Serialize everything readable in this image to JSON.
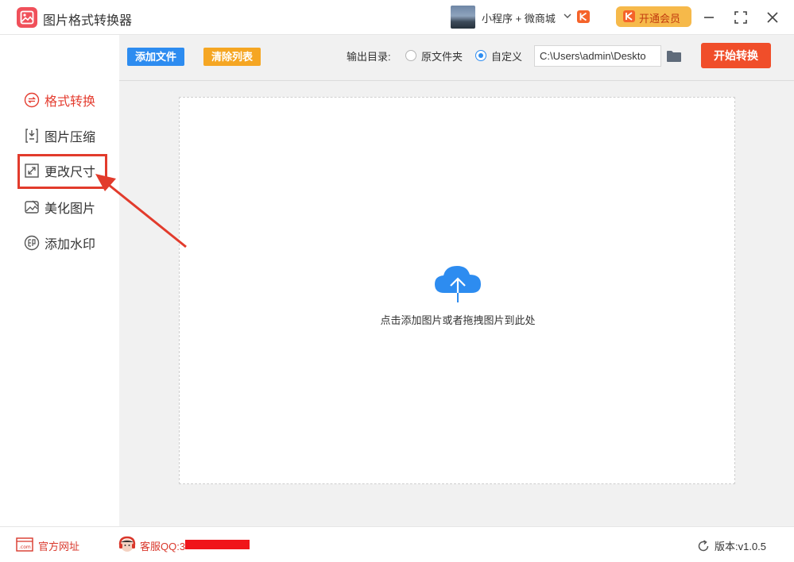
{
  "app": {
    "title": "图片格式转换器"
  },
  "header": {
    "mini_program_label": "小程序 + 微商城",
    "vip_label": "开通会员"
  },
  "sidebar": {
    "items": [
      {
        "label": "格式转换",
        "icon": "format-convert-icon",
        "active": true
      },
      {
        "label": "图片压缩",
        "icon": "compress-icon",
        "active": false
      },
      {
        "label": "更改尺寸",
        "icon": "resize-icon",
        "active": false
      },
      {
        "label": "美化图片",
        "icon": "beautify-icon",
        "active": false
      },
      {
        "label": "添加水印",
        "icon": "watermark-icon",
        "active": false
      }
    ]
  },
  "toolbar": {
    "add_file_label": "添加文件",
    "clear_list_label": "清除列表",
    "output_dir_label": "输出目录:",
    "option_original": "原文件夹",
    "option_custom": "自定义",
    "selected_option": "自定义",
    "output_path": "C:\\Users\\admin\\Deskto",
    "start_label": "开始转换"
  },
  "dropzone": {
    "hint": "点击添加图片或者拖拽图片到此处"
  },
  "footer": {
    "site_label": "官方网址",
    "service_label": "客服QQ:3",
    "version_label": "版本:v1.0.5"
  },
  "colors": {
    "accent": "#2d8cf0",
    "primary_action": "#f04e2a",
    "clear_button": "#f5a623",
    "highlight": "#e23b2c",
    "vip": "#f6b94a"
  }
}
